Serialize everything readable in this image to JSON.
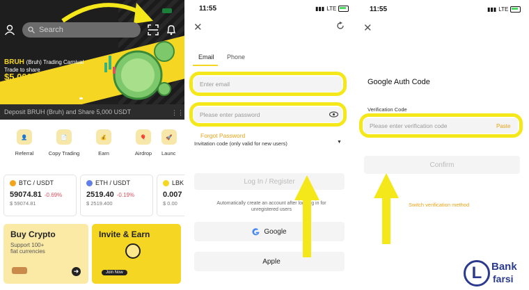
{
  "panel_home": {
    "search_placeholder": "Search",
    "promo": {
      "brand": "BRUH",
      "brand_sub": "(Bruh) Trading Carnival",
      "line2": "Trade to share",
      "amount": "$5,000 in $BRUH"
    },
    "deposit_banner": "Deposit BRUH (Bruh) and Share 5,000 USDT",
    "quick_actions": [
      "Referral",
      "Copy Trading",
      "Earn",
      "Airdrop",
      "Launc"
    ],
    "markets": [
      {
        "pair": "BTC / USDT",
        "price": "59074.81",
        "change": "-0.69%",
        "sub": "$ 59074.81",
        "color": "#f2a51a"
      },
      {
        "pair": "ETH / USDT",
        "price": "2519.40",
        "change": "-0.19%",
        "sub": "$ 2519.400",
        "color": "#627eea"
      },
      {
        "pair": "LBK",
        "price": "0.007",
        "change": "",
        "sub": "$ 0.00",
        "color": "#f5d622"
      }
    ],
    "buy_tile": {
      "title": "Buy Crypto",
      "line1": "Support 100+",
      "line2": "fiat currencies"
    },
    "invite_tile": {
      "title": "Invite & Earn",
      "join": "Join Now"
    }
  },
  "panel_login": {
    "time": "11:55",
    "network": "LTE",
    "tabs": [
      "Email",
      "Phone"
    ],
    "email_placeholder": "Enter email",
    "password_placeholder": "Please enter password",
    "forgot_password": "Forgot Password",
    "invitation_code": "Invitation code (only valid for new users)",
    "login_button": "Log In / Register",
    "notice_line1": "Automatically create an account after logging in for",
    "notice_line2": "unregistered users",
    "google_button": "Google",
    "apple_button": "Apple"
  },
  "panel_auth": {
    "time": "11:55",
    "network": "LTE",
    "title": "Google Auth Code",
    "field_label": "Verification Code",
    "field_placeholder": "Please enter verification code",
    "paste": "Paste",
    "confirm": "Confirm",
    "switch_method": "Switch verification method"
  },
  "watermark": {
    "text1": "Bank",
    "text2": "farsi",
    "letter": "L"
  },
  "colors": {
    "highlight": "#f5e81a",
    "accent_orange": "#e8a317",
    "down_red": "#e04f5f",
    "brand_yellow": "#f5d622"
  }
}
